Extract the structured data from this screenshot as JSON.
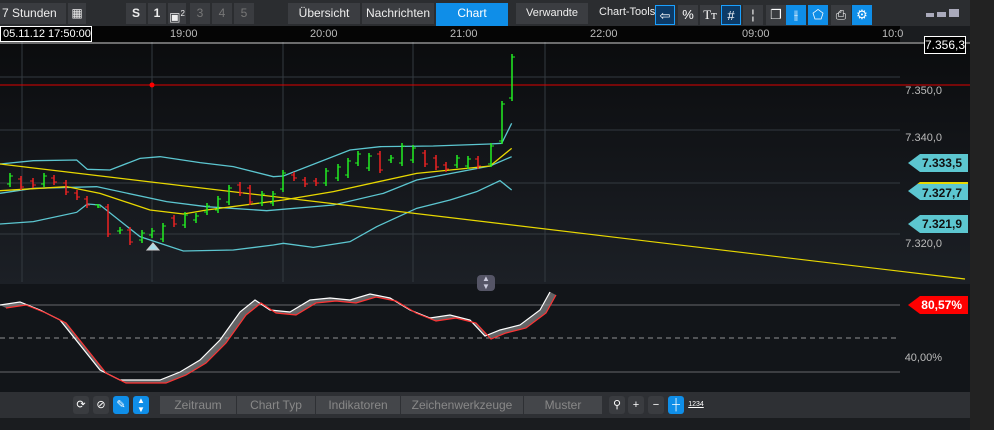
{
  "toolbar": {
    "period": "7 Stunden",
    "buttons": [
      "S",
      "1",
      "3",
      "4",
      "5"
    ],
    "save_badge": "2",
    "tabs": [
      "Übersicht",
      "Nachrichten",
      "Chart",
      "Verwandte"
    ],
    "chart_tools": "Chart-Tools",
    "tools": [
      "back-icon",
      "percent-icon",
      "text-icon",
      "grid-icon",
      "candle-icon",
      "layers-icon",
      "bars-icon",
      "tag-icon",
      "print-icon",
      "settings-icon"
    ]
  },
  "timebar": {
    "date": "05.11.12 17:50:00",
    "times": [
      "19:00",
      "20:00",
      "21:00",
      "22:00",
      "09:00",
      "10:0"
    ]
  },
  "price_axis": {
    "current": "7.356,3",
    "labels": [
      "7.350,0",
      "7.340,0",
      "7.320,0"
    ],
    "tags": [
      "7.333,5",
      "7.327,7",
      "7.321,9"
    ]
  },
  "oscillator": {
    "current": "80,57%",
    "label": "40,00%"
  },
  "bottom": {
    "menus": [
      "Zeitraum",
      "Chart Typ",
      "Indikatoren",
      "Zeichenwerkzeuge",
      "Muster"
    ],
    "scale_label": "1234"
  },
  "colors": {
    "accent": "#0f8ee8",
    "up": "#22ee22",
    "down": "#ee2222",
    "band": "#5cc6d0",
    "ma": "#e8d800"
  }
}
